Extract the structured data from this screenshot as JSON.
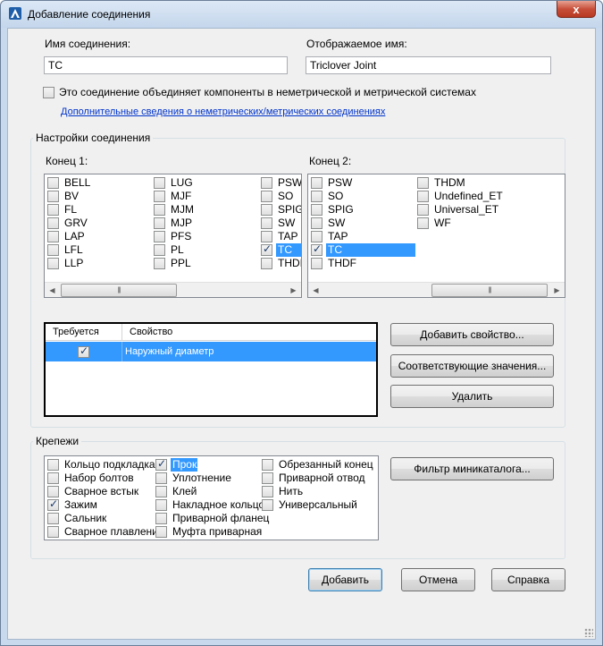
{
  "window": {
    "title": "Добавление соединения",
    "close_glyph": "x"
  },
  "connection_name": {
    "label": "Имя соединения:",
    "value": "TC"
  },
  "display_name": {
    "label": "Отображаемое имя:",
    "value": "Triclover Joint"
  },
  "mixed_systems": {
    "label": "Это соединение объединяет компоненты в неметрической и метрической системах",
    "checked": false
  },
  "more_info_link": "Дополнительные сведения о неметрических/метрических соединениях",
  "settings_group": {
    "title": "Настройки соединения",
    "end1_label": "Конец 1:",
    "end2_label": "Конец 2:",
    "end1_columns": [
      [
        {
          "text": "BELL",
          "checked": false
        },
        {
          "text": "BV",
          "checked": false
        },
        {
          "text": "FL",
          "checked": false
        },
        {
          "text": "GRV",
          "checked": false
        },
        {
          "text": "LAP",
          "checked": false
        },
        {
          "text": "LFL",
          "checked": false
        },
        {
          "text": "LLP",
          "checked": false
        }
      ],
      [
        {
          "text": "LUG",
          "checked": false
        },
        {
          "text": "MJF",
          "checked": false
        },
        {
          "text": "MJM",
          "checked": false
        },
        {
          "text": "MJP",
          "checked": false
        },
        {
          "text": "PFS",
          "checked": false
        },
        {
          "text": "PL",
          "checked": false
        },
        {
          "text": "PPL",
          "checked": false
        }
      ],
      [
        {
          "text": "PSW",
          "checked": false
        },
        {
          "text": "SO",
          "checked": false
        },
        {
          "text": "SPIG",
          "checked": false
        },
        {
          "text": "SW",
          "checked": false
        },
        {
          "text": "TAP",
          "checked": false
        },
        {
          "text": "TC",
          "checked": true,
          "selected": true
        },
        {
          "text": "THDI",
          "checked": false
        }
      ]
    ],
    "end2_columns": [
      [
        {
          "text": "PSW",
          "checked": false
        },
        {
          "text": "SO",
          "checked": false
        },
        {
          "text": "SPIG",
          "checked": false
        },
        {
          "text": "SW",
          "checked": false
        },
        {
          "text": "TAP",
          "checked": false
        },
        {
          "text": "TC",
          "checked": true,
          "selected": true
        },
        {
          "text": "THDF",
          "checked": false
        }
      ],
      [
        {
          "text": "THDM",
          "checked": false
        },
        {
          "text": "Undefined_ET",
          "checked": false
        },
        {
          "text": "Universal_ET",
          "checked": false
        },
        {
          "text": "WF",
          "checked": false
        }
      ]
    ],
    "properties_table": {
      "columns": [
        "Требуется",
        "Свойство"
      ],
      "rows": [
        {
          "required": true,
          "property": "Наружный диаметр"
        }
      ]
    },
    "add_property_button": "Добавить свойство...",
    "matching_values_button": "Соответствующие значения...",
    "delete_button": "Удалить"
  },
  "fasteners_group": {
    "title": "Крепежи",
    "columns": [
      [
        {
          "text": "Кольцо подкладка",
          "checked": false
        },
        {
          "text": "Набор болтов",
          "checked": false
        },
        {
          "text": "Сварное встык",
          "checked": false
        },
        {
          "text": "Зажим",
          "checked": true
        },
        {
          "text": "Сальник",
          "checked": false
        },
        {
          "text": "Сварное плавление",
          "checked": false
        }
      ],
      [
        {
          "text": "Прокладки",
          "checked": true,
          "selected": true
        },
        {
          "text": "Уплотнение",
          "checked": false
        },
        {
          "text": "Клей",
          "checked": false
        },
        {
          "text": "Накладное кольцо",
          "checked": false
        },
        {
          "text": "Приварной фланец",
          "checked": false
        },
        {
          "text": "Муфта приварная",
          "checked": false
        }
      ],
      [
        {
          "text": "Обрезанный конец",
          "checked": false
        },
        {
          "text": "Приварной отвод",
          "checked": false
        },
        {
          "text": "Нить",
          "checked": false
        },
        {
          "text": "Универсальный",
          "checked": false
        }
      ]
    ],
    "filter_button": "Фильтр миникаталога..."
  },
  "footer": {
    "add_button": "Добавить",
    "cancel_button": "Отмена",
    "help_button": "Справка"
  },
  "colors": {
    "selection": "#3399ff",
    "link": "#0033cc",
    "frame": "#c9d9ed"
  }
}
